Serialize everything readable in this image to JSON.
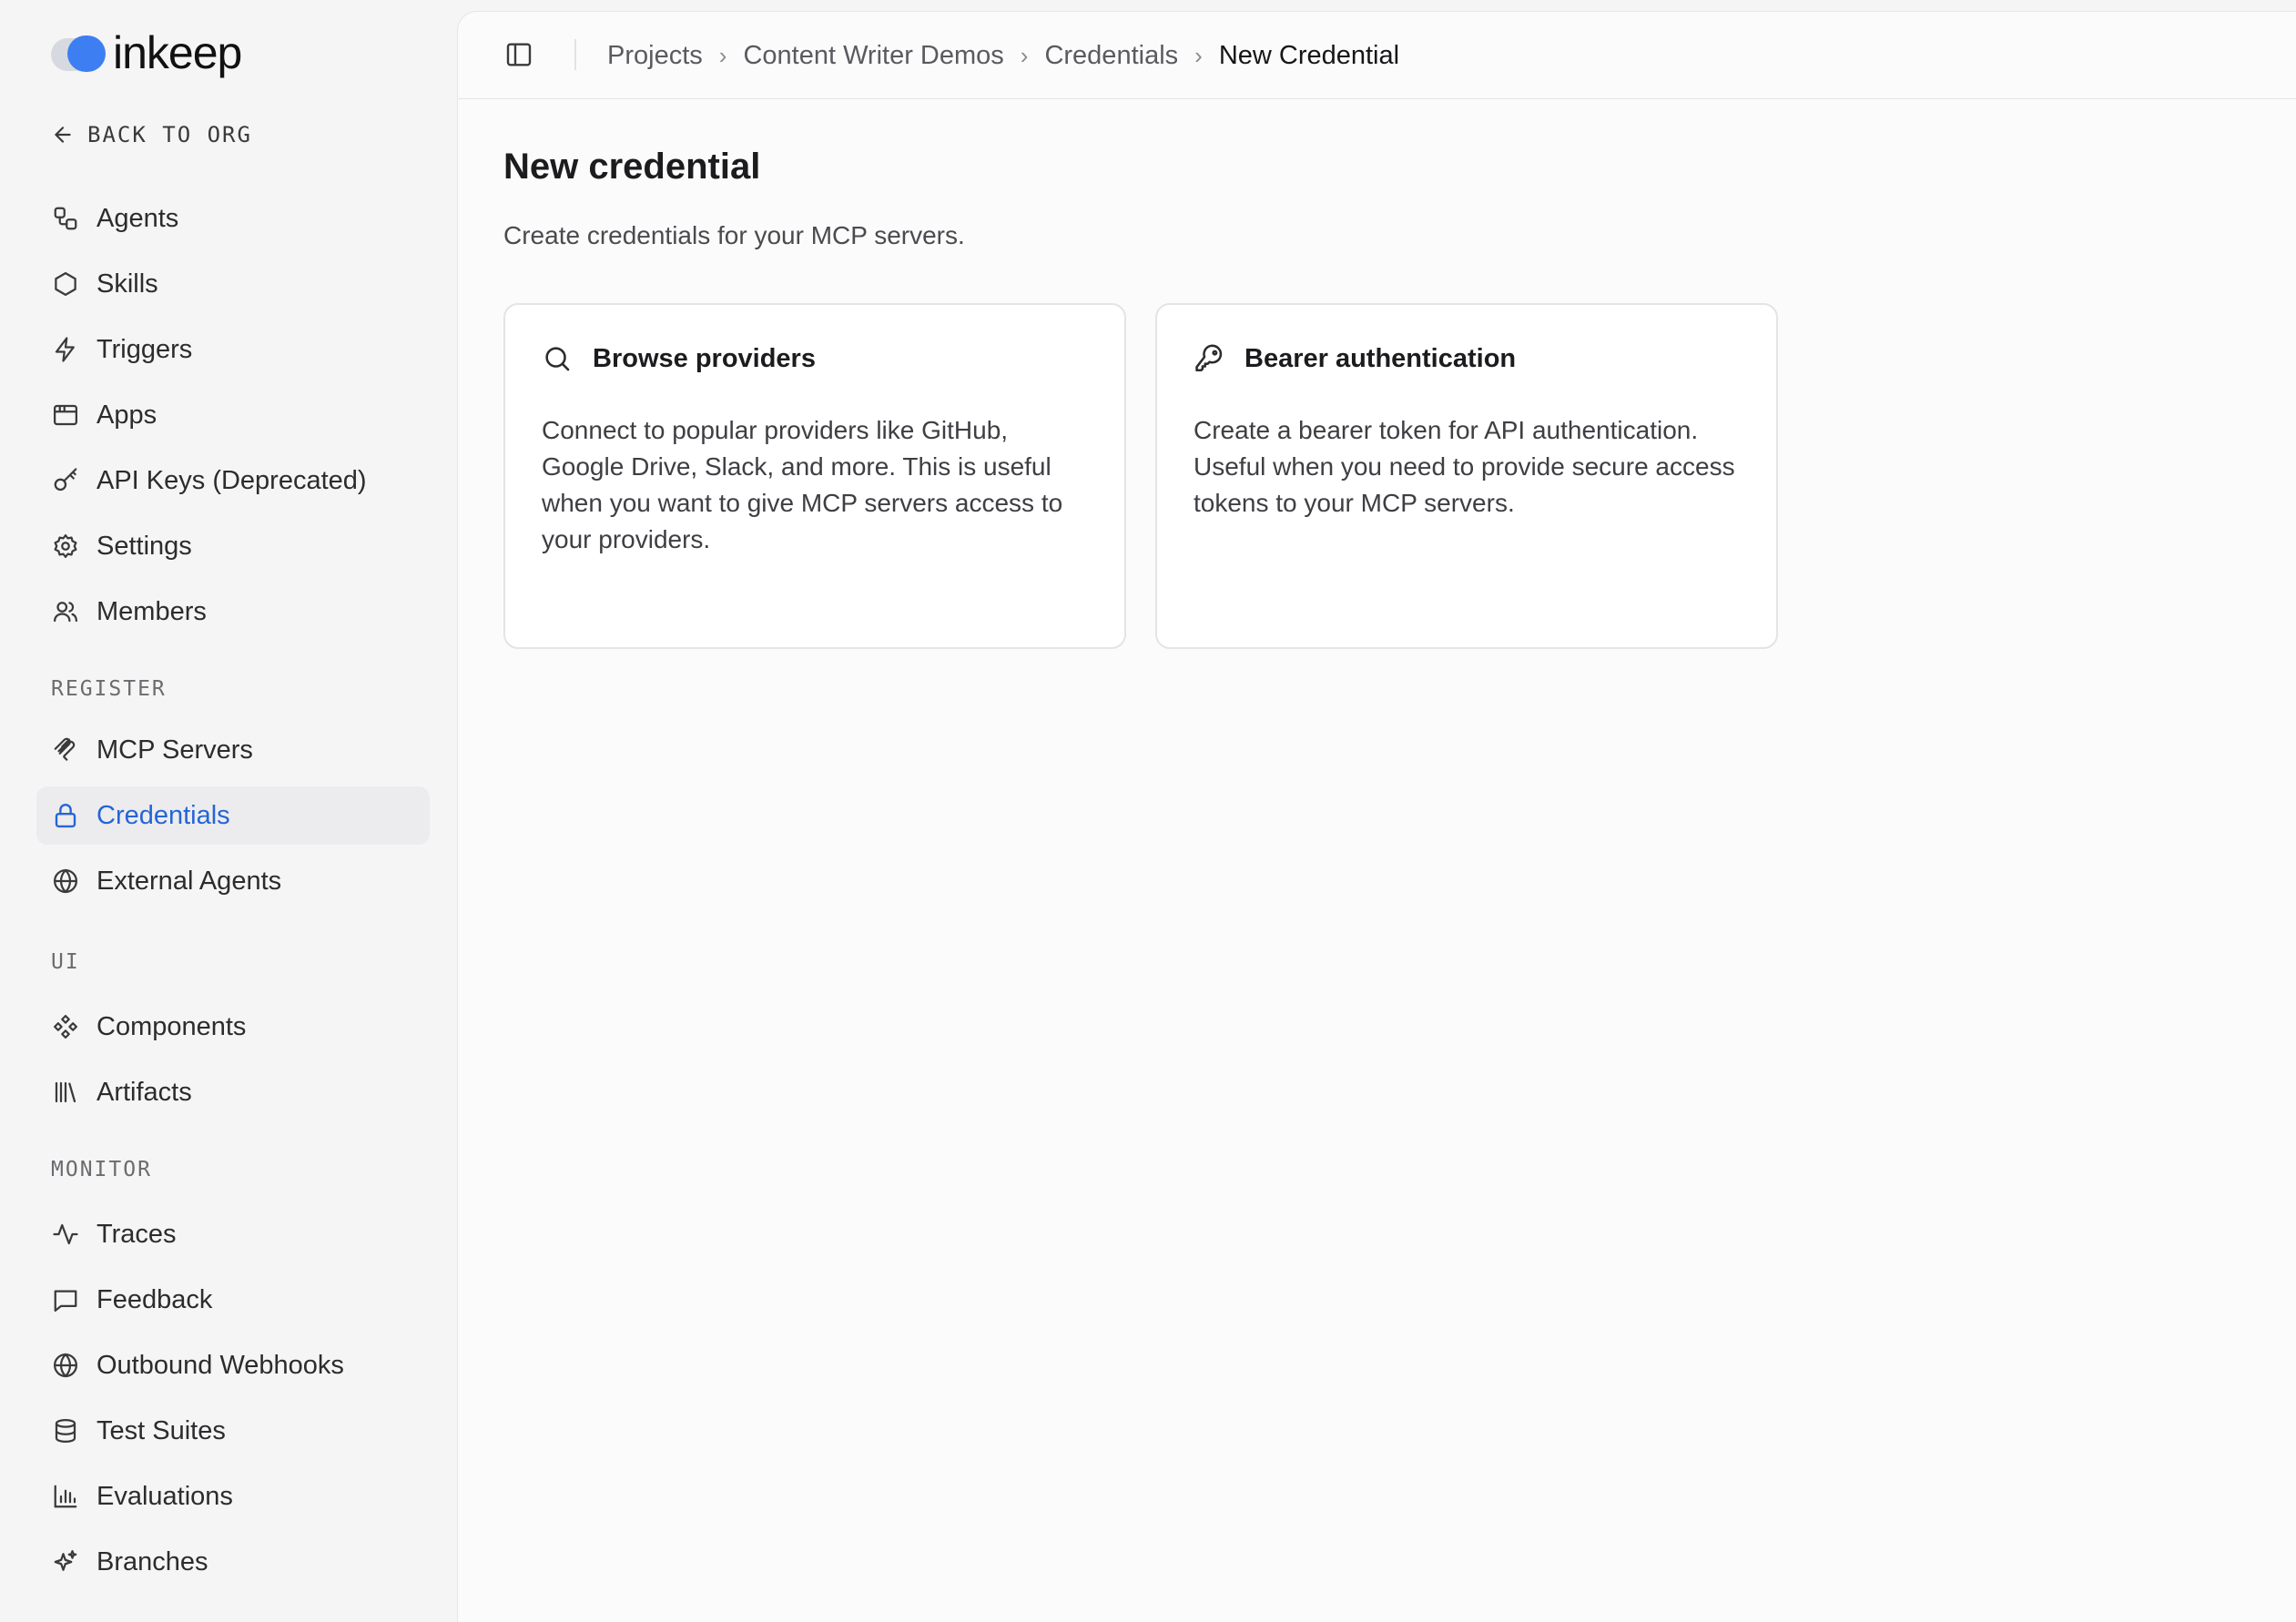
{
  "brand": {
    "name": "inkeep"
  },
  "sidebar": {
    "back_label": "BACK TO ORG",
    "items": [
      {
        "label": "Agents",
        "icon": "workflow-icon"
      },
      {
        "label": "Skills",
        "icon": "hexagon-icon"
      },
      {
        "label": "Triggers",
        "icon": "zap-icon"
      },
      {
        "label": "Apps",
        "icon": "app-window-icon"
      },
      {
        "label": "API Keys (Deprecated)",
        "icon": "key-icon"
      },
      {
        "label": "Settings",
        "icon": "gear-icon"
      },
      {
        "label": "Members",
        "icon": "users-icon"
      }
    ],
    "sections": [
      {
        "label": "REGISTER",
        "items": [
          {
            "label": "MCP Servers",
            "icon": "mcp-icon"
          },
          {
            "label": "Credentials",
            "icon": "lock-icon",
            "active": true
          },
          {
            "label": "External Agents",
            "icon": "globe-icon"
          }
        ]
      },
      {
        "label": "UI",
        "items": [
          {
            "label": "Components",
            "icon": "component-icon"
          },
          {
            "label": "Artifacts",
            "icon": "library-icon"
          }
        ]
      },
      {
        "label": "MONITOR",
        "items": [
          {
            "label": "Traces",
            "icon": "activity-icon"
          },
          {
            "label": "Feedback",
            "icon": "message-square-icon"
          },
          {
            "label": "Outbound Webhooks",
            "icon": "globe-icon"
          },
          {
            "label": "Test Suites",
            "icon": "database-icon"
          },
          {
            "label": "Evaluations",
            "icon": "bar-chart-icon"
          },
          {
            "label": "Branches",
            "icon": "sparkles-icon"
          }
        ]
      }
    ]
  },
  "breadcrumb": [
    "Projects",
    "Content Writer Demos",
    "Credentials",
    "New Credential"
  ],
  "page": {
    "title": "New credential",
    "subtitle": "Create credentials for your MCP servers."
  },
  "cards": [
    {
      "title": "Browse providers",
      "icon": "search-icon",
      "description": "Connect to popular providers like GitHub, Google Drive, Slack, and more. This is useful when you want to give MCP servers access to your providers."
    },
    {
      "title": "Bearer authentication",
      "icon": "key-round-icon",
      "description": "Create a bearer token for API authentication. Useful when you need to provide secure access tokens to your MCP servers."
    }
  ],
  "colors": {
    "accent": "#2565d6",
    "active_bg": "#ececee",
    "logo_blue": "#3d7ff2"
  }
}
